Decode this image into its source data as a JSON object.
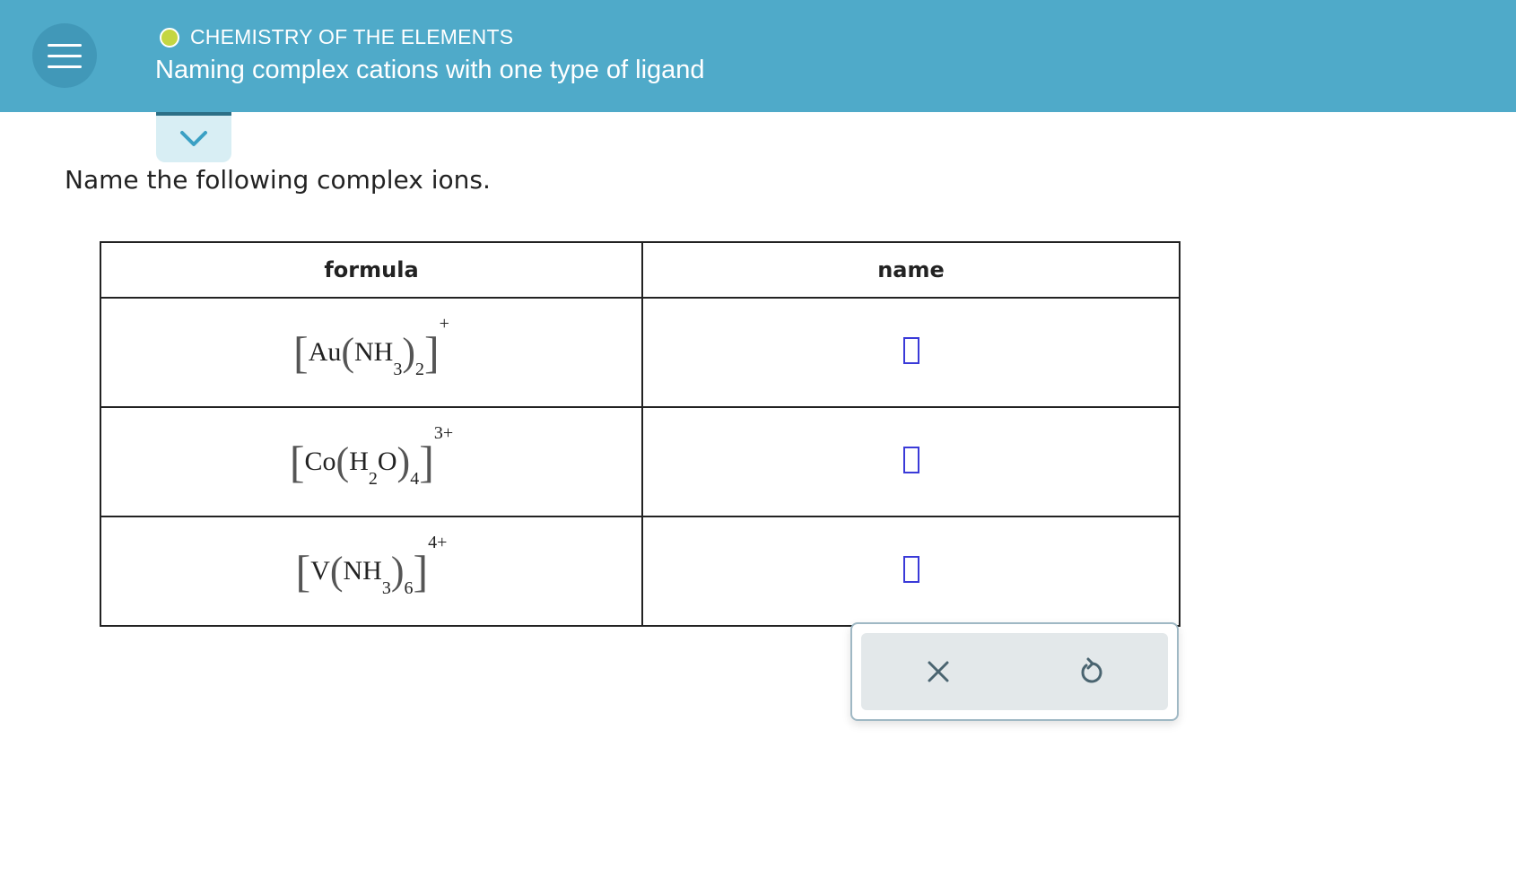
{
  "header": {
    "topic": "CHEMISTRY OF THE ELEMENTS",
    "title": "Naming complex cations with one type of ligand"
  },
  "prompt": "Name the following complex ions.",
  "table": {
    "columns": [
      "formula",
      "name"
    ],
    "rows": [
      {
        "metal": "Au",
        "ligand": "NH",
        "ligand_sub": "3",
        "count": "2",
        "charge": "+",
        "name_value": ""
      },
      {
        "metal": "Co",
        "ligand_pre": "H",
        "ligand_pre_sub": "2",
        "ligand_post": "O",
        "count": "4",
        "charge": "3+",
        "name_value": ""
      },
      {
        "metal": "V",
        "ligand": "NH",
        "ligand_sub": "3",
        "count": "6",
        "charge": "4+",
        "name_value": ""
      }
    ]
  },
  "icons": {
    "menu": "hamburger-icon",
    "collapse": "chevron-down-icon",
    "clear": "close-icon",
    "reset": "undo-icon"
  },
  "colors": {
    "header": "#4faac9",
    "accent_dot": "#c4d642",
    "answer_box": "#3a3ad8"
  }
}
